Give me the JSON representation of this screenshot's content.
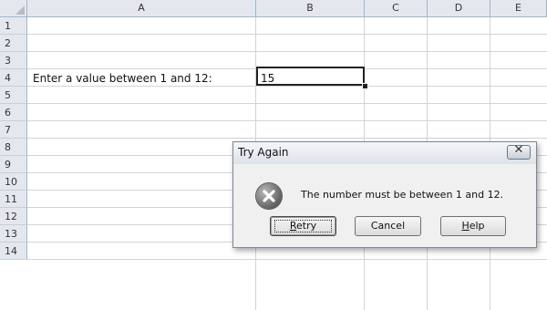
{
  "sheet": {
    "columns": [
      "A",
      "B",
      "C",
      "D",
      "E"
    ],
    "rows": [
      "1",
      "2",
      "3",
      "4",
      "5",
      "6",
      "7",
      "8",
      "9",
      "10",
      "11",
      "12",
      "13",
      "14"
    ],
    "cells": {
      "A3": "Enter a value between 1 and 12:",
      "B3": "15"
    }
  },
  "dialog": {
    "title": "Try Again",
    "close_label": "✕",
    "message": "The number must be between 1 and 12.",
    "icon": "error-icon",
    "buttons": {
      "retry": {
        "prefix": "",
        "mnemonic": "R",
        "suffix": "etry"
      },
      "cancel": "Cancel",
      "help": {
        "prefix": "",
        "mnemonic": "H",
        "suffix": "elp"
      }
    }
  }
}
